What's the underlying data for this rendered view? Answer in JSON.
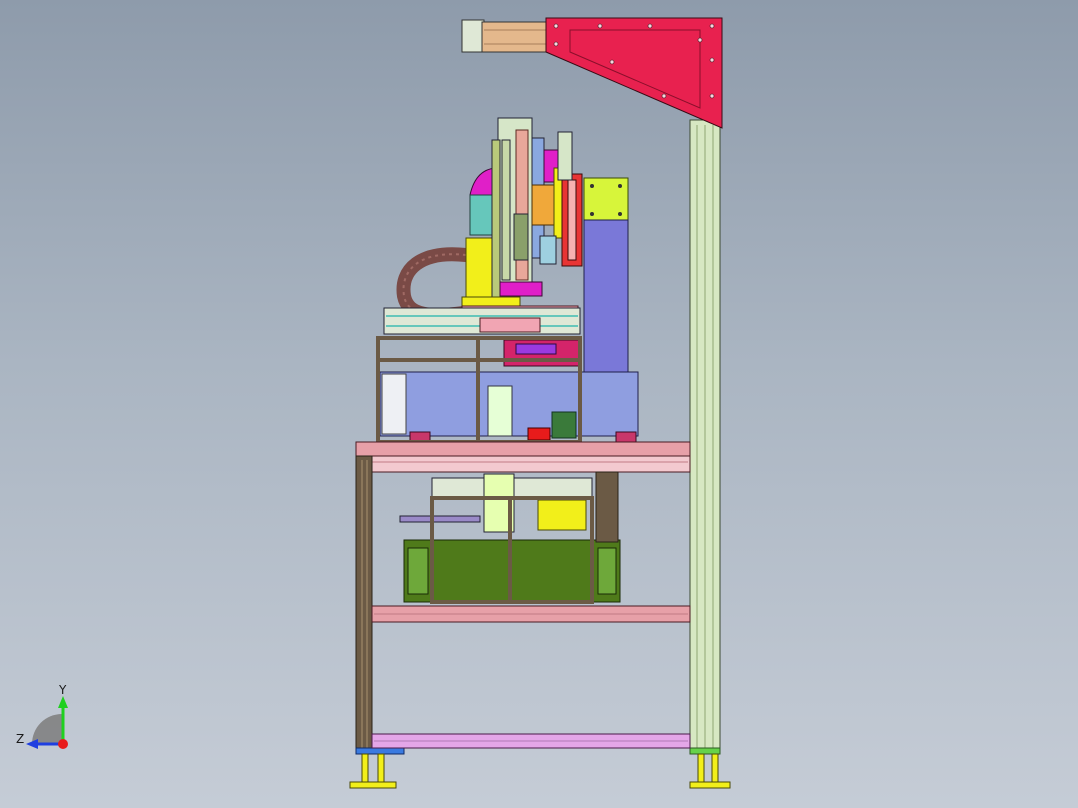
{
  "viewport": {
    "background_top": "#8e9bab",
    "background_bottom": "#c5ccd6"
  },
  "model": {
    "colors": {
      "frame_profile": "#d7e8c2",
      "gantry_plate": "#e8214f",
      "table_top": "#e7a0a8",
      "leg_profile": "#6b5a45",
      "base_unit": "#8f9ee0",
      "column": "#7a78d8",
      "hood": "#4f7a1a",
      "accent_yellow": "#f2ef1a",
      "accent_green": "#d7f53a",
      "accent_magenta": "#e01fc8",
      "accent_teal": "#66c7bb",
      "cable": "#7a4a46"
    }
  },
  "triad": {
    "y_label": "Y",
    "z_label": "Z",
    "y_color": "#1fd01f",
    "z_color": "#1f3fe0",
    "origin_color": "#e81b1b"
  }
}
